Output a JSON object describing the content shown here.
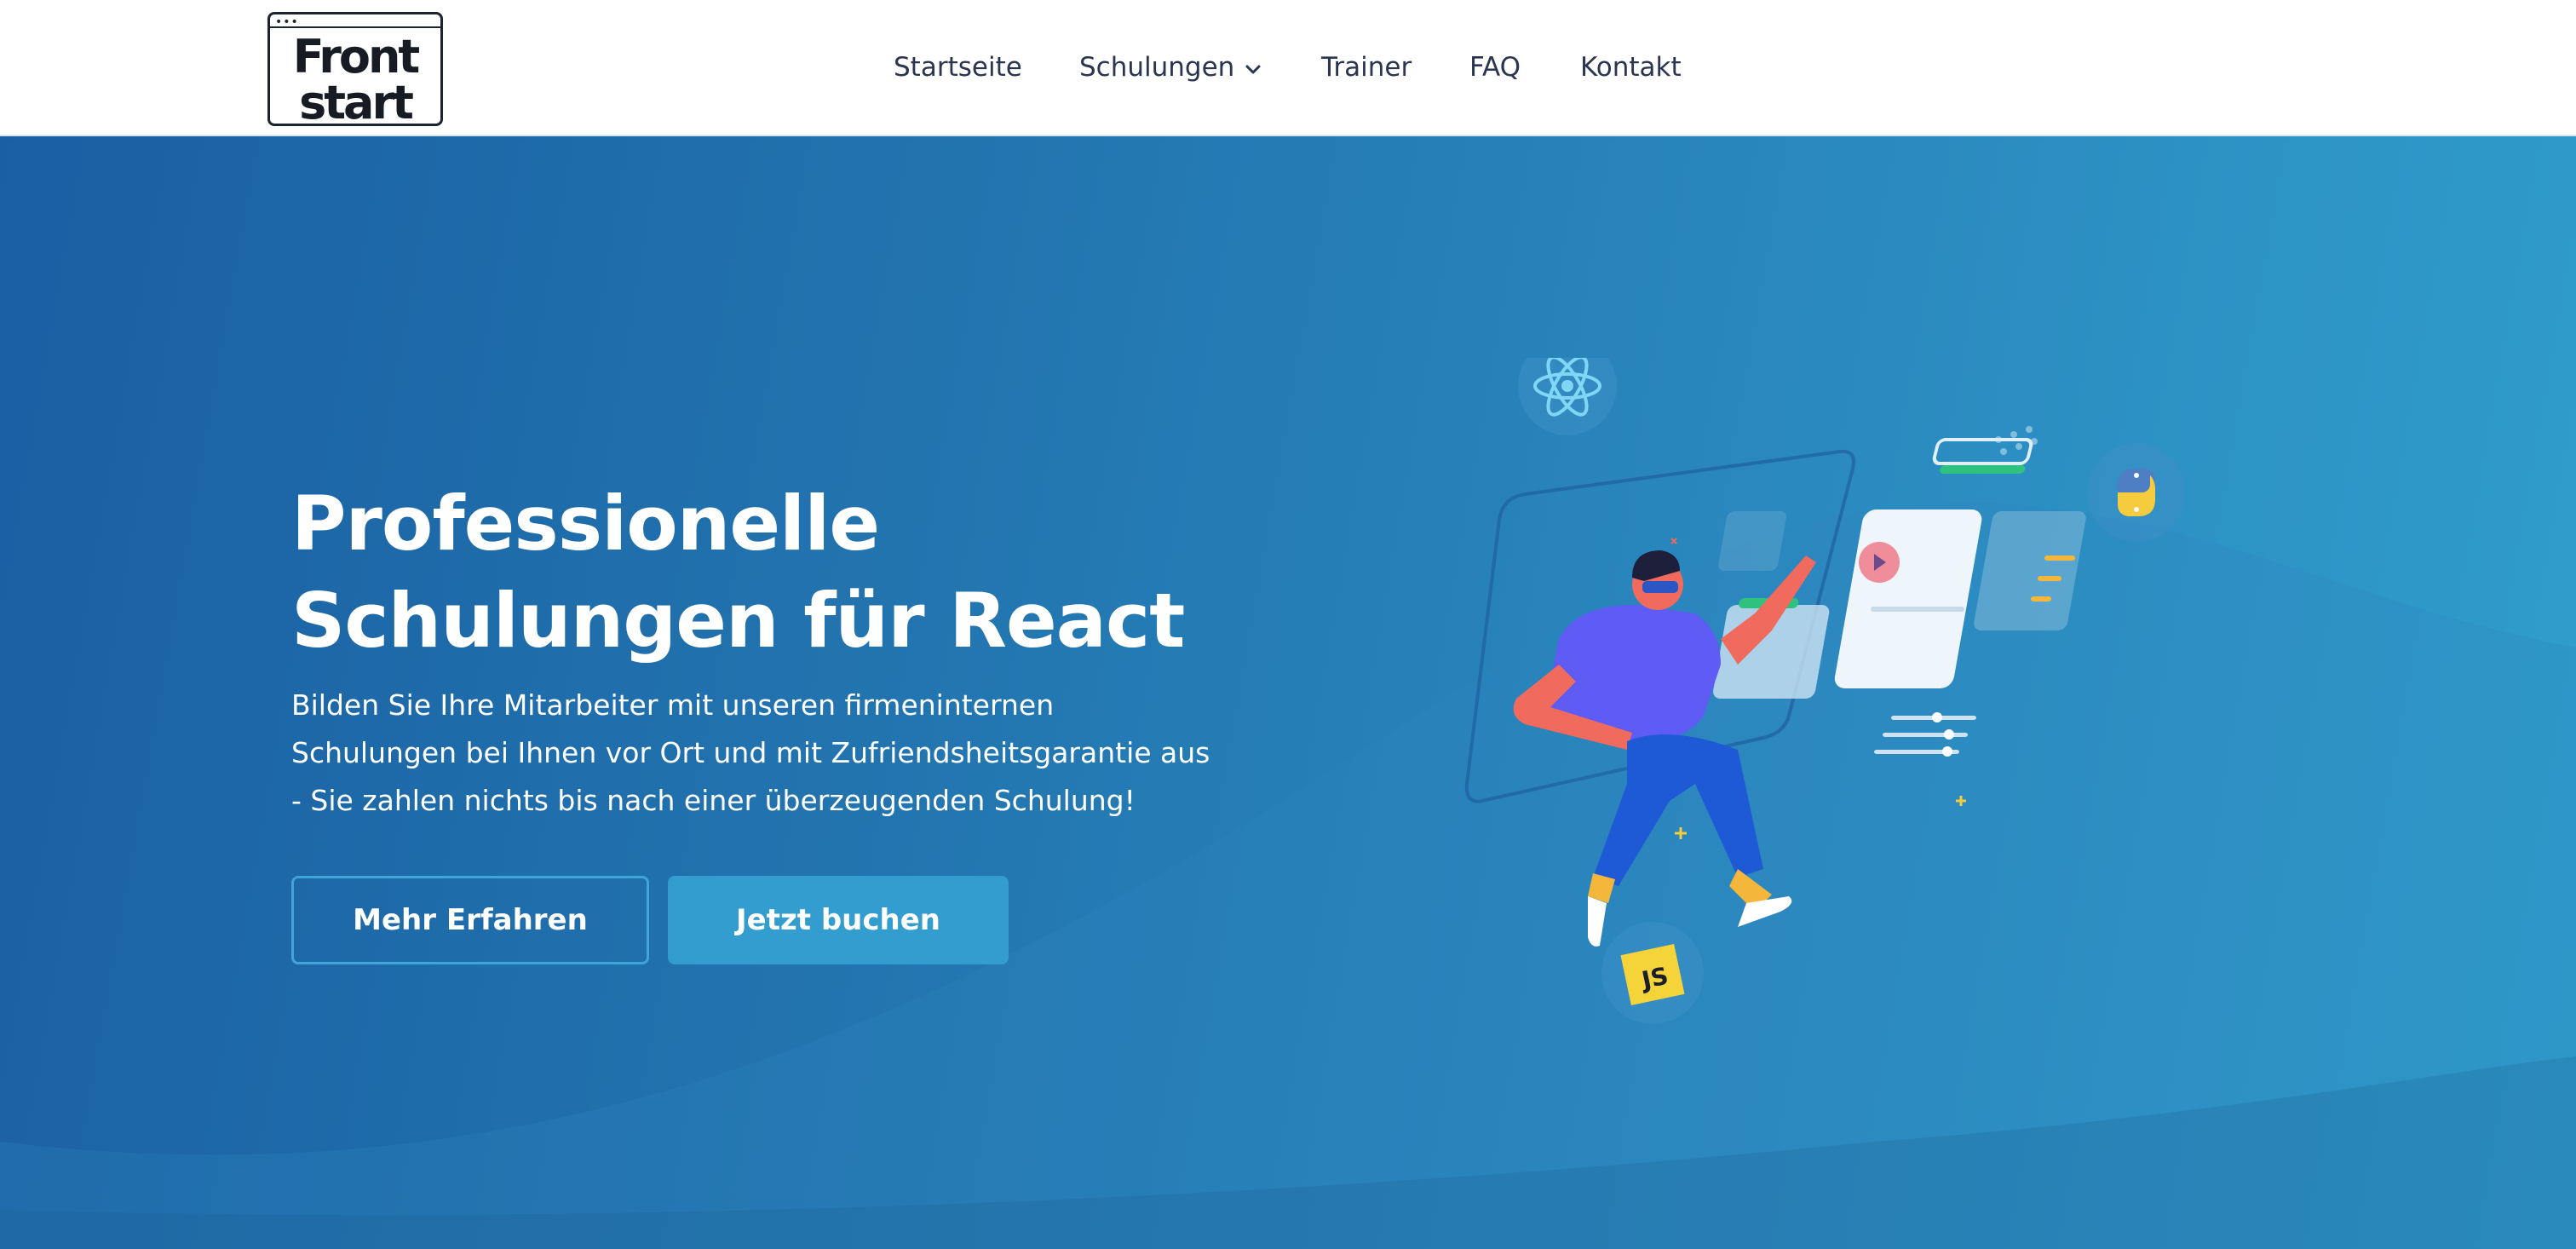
{
  "header": {
    "logo": {
      "line1": "Front",
      "line2": "start",
      "dots": "•••"
    },
    "nav": [
      {
        "label": "Startseite"
      },
      {
        "label": "Schulungen",
        "has_dropdown": true,
        "icon": "chevron-down-icon"
      },
      {
        "label": "Trainer"
      },
      {
        "label": "FAQ"
      },
      {
        "label": "Kontakt"
      }
    ]
  },
  "hero": {
    "title_lines": [
      "Professionelle",
      "Schulungen für React"
    ],
    "subtitle_lines": [
      "Bilden Sie Ihre Mitarbeiter mit unseren firmeninternen",
      "Schulungen bei Ihnen vor Ort und mit Zufriendsheitsgarantie aus",
      "- Sie zahlen nichts bis nach einer überzeugenden Schulung!"
    ],
    "buttons": {
      "more": "Mehr Erfahren",
      "book": "Jetzt buchen"
    },
    "illustration": {
      "icons": [
        "react-icon",
        "python-icon",
        "javascript-icon"
      ],
      "js_label": "JS"
    }
  },
  "colors": {
    "hero_gradient_start": "#1a5fa3",
    "hero_gradient_end": "#309fcd",
    "button_primary": "#339dcf",
    "nav_text": "#2a3550"
  }
}
